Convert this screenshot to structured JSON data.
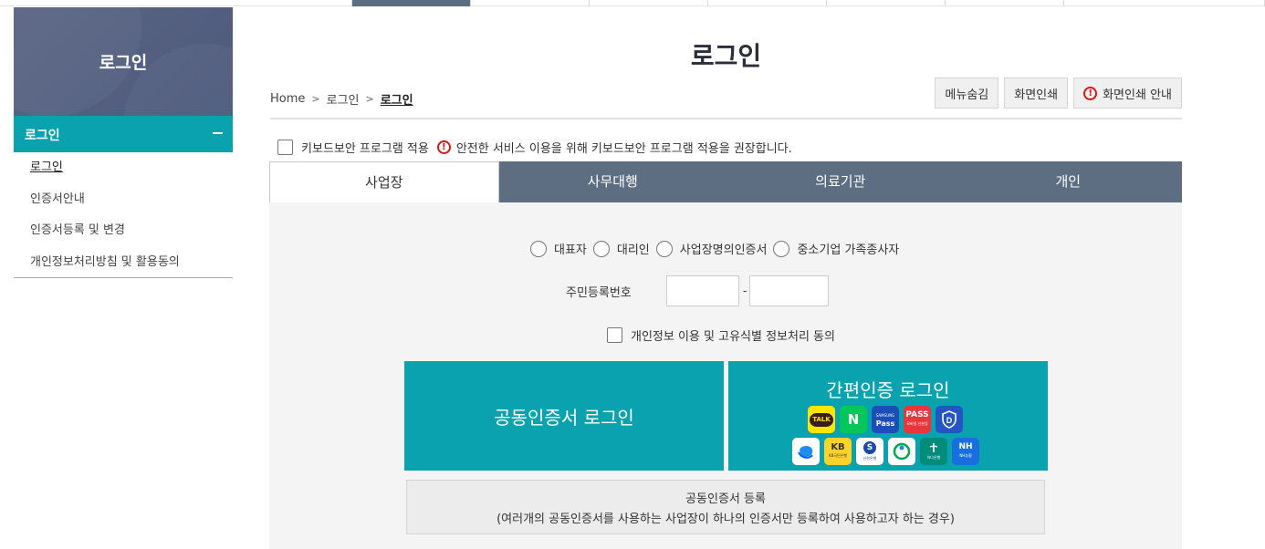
{
  "sidebar": {
    "banner_title": "로그인",
    "section_title": "로그인",
    "items": [
      {
        "label": "로그인",
        "active": true
      },
      {
        "label": "인증서안내"
      },
      {
        "label": "인증서등록 및 변경"
      },
      {
        "label": "개인정보처리방침 및 활용동의"
      }
    ]
  },
  "header": {
    "title": "로그인",
    "breadcrumb": [
      "Home",
      "로그인",
      "로그인"
    ],
    "buttons": {
      "hide_menu": "메뉴숨김",
      "print": "화면인쇄",
      "print_guide": "화면인쇄 안내"
    }
  },
  "keyboard_security": {
    "label": "키보드보안 프로그램 적용",
    "notice": "안전한 서비스 이용을 위해 키보드보안 프로그램 적용을 권장합니다."
  },
  "tabs": [
    "사업장",
    "사무대행",
    "의료기관",
    "개인"
  ],
  "form": {
    "user_types": [
      "대표자",
      "대리인",
      "사업장명의인증서",
      "중소기업 가족종사자"
    ],
    "ssn_label": "주민등록번호",
    "ssn_separator": "-",
    "agree_label": "개인정보 이용 및 고유식별 정보처리 동의"
  },
  "login": {
    "cert_login": "공동인증서 로그인",
    "easy_login": "간편인증 로그인",
    "providers": [
      "TALK",
      "N",
      "Samsung Pass",
      "PASS",
      "D",
      "toss",
      "KB",
      "S",
      "payco",
      "하나",
      "NH"
    ],
    "provider_captions": {
      "samsung": "SAMSUNG",
      "samsung_pass": "Pass",
      "pass_sub": "모바일 신분증",
      "kb_sub": "KB국민은행",
      "shinhan_sub": "신한은행",
      "hana_sub": "하나은행",
      "nh_sub": "NH농협"
    }
  },
  "register": {
    "title": "공동인증서 등록",
    "desc": "(여러개의 공동인증서를 사용하는 사업장이 하나의 인증서만 등록하여 사용하고자 하는 경우)"
  },
  "colors": {
    "accent": "#0aa2ae",
    "tab_bg": "#5d6d82",
    "banner": "#545f80",
    "alert": "#d81818"
  }
}
